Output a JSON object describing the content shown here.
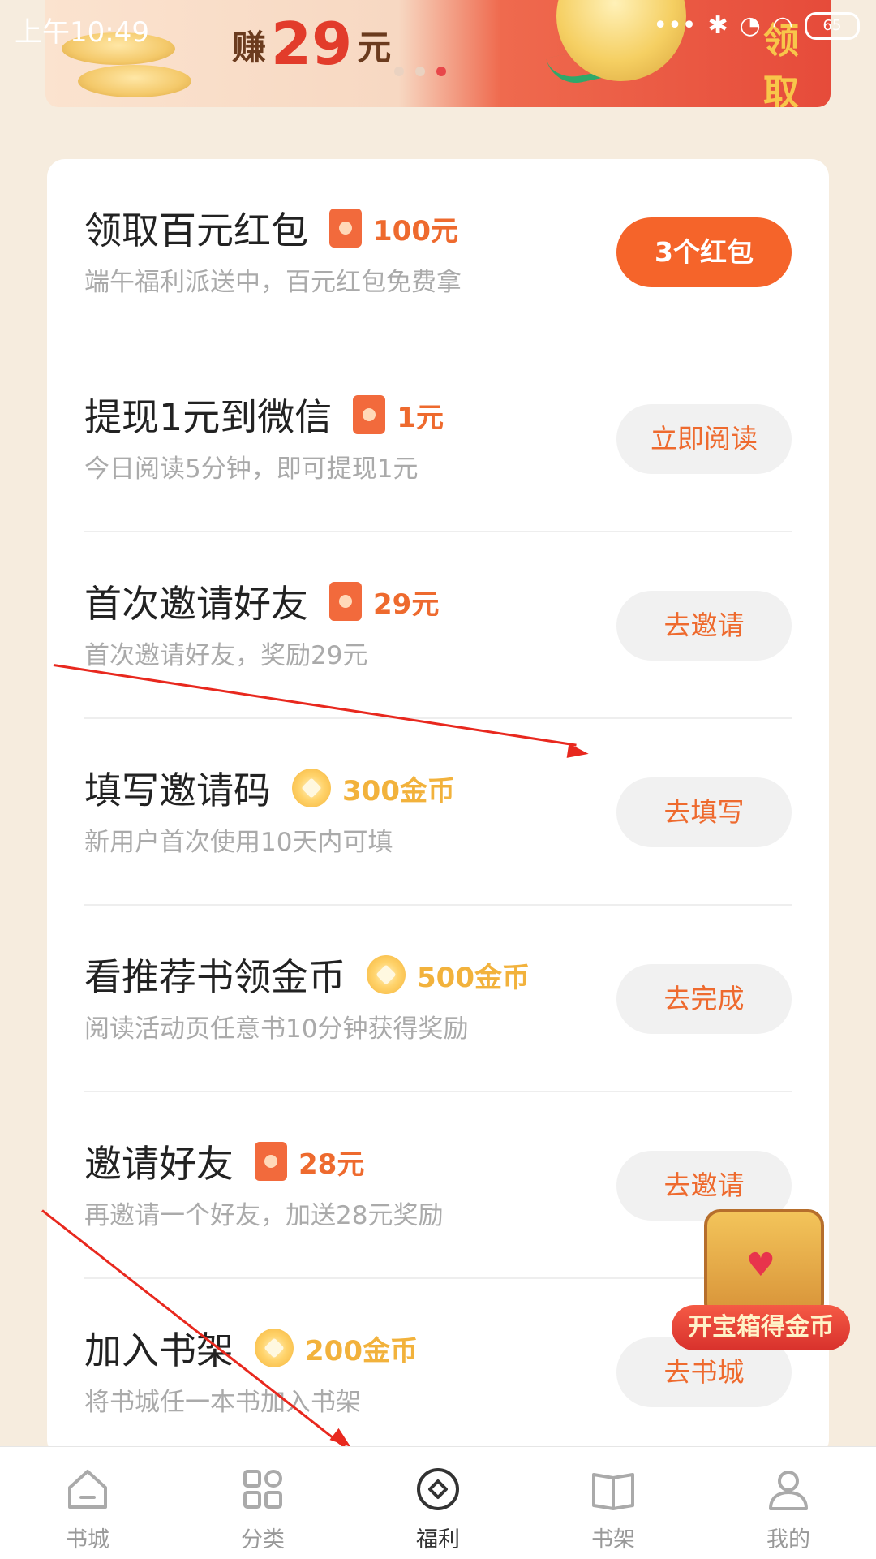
{
  "status_bar": {
    "time": "上午10:49",
    "icons": [
      "more-dots-icon",
      "bluetooth-icon",
      "alarm-icon",
      "wifi-icon"
    ],
    "battery": "65"
  },
  "banner": {
    "earn_prefix": "赚",
    "earn_amount": "29",
    "earn_suffix": "元",
    "receive_label": "领取",
    "page_dots": 3,
    "active_dot": 3
  },
  "tasks": [
    {
      "title": "领取百元红包",
      "reward_type": "red-envelope",
      "reward": "100元",
      "desc": "端午福利派送中，百元红包免费拿",
      "button": "3个红包",
      "primary": true
    },
    {
      "title": "提现1元到微信",
      "reward_type": "red-envelope",
      "reward": "1元",
      "desc": "今日阅读5分钟，即可提现1元",
      "button": "立即阅读",
      "primary": false
    },
    {
      "title": "首次邀请好友",
      "reward_type": "red-envelope",
      "reward": "29元",
      "desc": "首次邀请好友，奖励29元",
      "button": "去邀请",
      "primary": false
    },
    {
      "title": "填写邀请码",
      "reward_type": "coin",
      "reward": "300金币",
      "desc": "新用户首次使用10天内可填",
      "button": "去填写",
      "primary": false
    },
    {
      "title": "看推荐书领金币",
      "reward_type": "coin",
      "reward": "500金币",
      "desc": "阅读活动页任意书10分钟获得奖励",
      "button": "去完成",
      "primary": false
    },
    {
      "title": "邀请好友",
      "reward_type": "red-envelope",
      "reward": "28元",
      "desc": "再邀请一个好友，加送28元奖励",
      "button": "去邀请",
      "primary": false
    },
    {
      "title": "加入书架",
      "reward_type": "coin",
      "reward": "200金币",
      "desc": "将书城任一本书加入书架",
      "button": "去书城",
      "primary": false
    }
  ],
  "treasure_chest": {
    "label": "开宝箱得金币"
  },
  "bottom_nav": [
    {
      "label": "书城",
      "icon": "home-icon",
      "active": false
    },
    {
      "label": "分类",
      "icon": "grid-icon",
      "active": false
    },
    {
      "label": "福利",
      "icon": "welfare-icon",
      "active": true
    },
    {
      "label": "书架",
      "icon": "book-icon",
      "active": false
    },
    {
      "label": "我的",
      "icon": "user-icon",
      "active": false
    }
  ],
  "colors": {
    "accent": "#f5642a",
    "reward_red": "#ee6a2e",
    "reward_gold": "#f2b23c",
    "background": "#f6ecde",
    "annotation_arrow": "#e8281e"
  }
}
